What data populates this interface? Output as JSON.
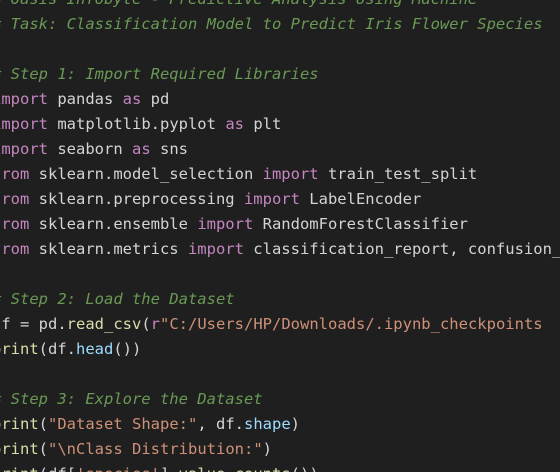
{
  "editor": {
    "colors": {
      "background": "#1f1f1f",
      "comment": "#6a9955",
      "keyword": "#c586c0",
      "function": "#dcdcaa",
      "string": "#ce9178",
      "attribute": "#9cdcfe",
      "plain": "#d4d4d4"
    },
    "lines": [
      [
        {
          "t": "comment",
          "v": "# Oasis Infobyte - Predictive Analysis Using Machine"
        }
      ],
      [
        {
          "t": "comment",
          "v": "# Task: Classification Model to Predict Iris Flower Species"
        }
      ],
      [],
      [
        {
          "t": "comment",
          "v": "# Step 1: Import Required Libraries"
        }
      ],
      [
        {
          "t": "keyword",
          "v": "import"
        },
        {
          "t": "plain",
          "v": " pandas "
        },
        {
          "t": "keyword",
          "v": "as"
        },
        {
          "t": "plain",
          "v": " pd"
        }
      ],
      [
        {
          "t": "keyword",
          "v": "import"
        },
        {
          "t": "plain",
          "v": " matplotlib.pyplot "
        },
        {
          "t": "keyword",
          "v": "as"
        },
        {
          "t": "plain",
          "v": " plt"
        }
      ],
      [
        {
          "t": "keyword",
          "v": "import"
        },
        {
          "t": "plain",
          "v": " seaborn "
        },
        {
          "t": "keyword",
          "v": "as"
        },
        {
          "t": "plain",
          "v": " sns"
        }
      ],
      [
        {
          "t": "keyword",
          "v": "from"
        },
        {
          "t": "plain",
          "v": " sklearn.model_selection "
        },
        {
          "t": "keyword",
          "v": "import"
        },
        {
          "t": "plain",
          "v": " train_test_split"
        }
      ],
      [
        {
          "t": "keyword",
          "v": "from"
        },
        {
          "t": "plain",
          "v": " sklearn.preprocessing "
        },
        {
          "t": "keyword",
          "v": "import"
        },
        {
          "t": "plain",
          "v": " LabelEncoder"
        }
      ],
      [
        {
          "t": "keyword",
          "v": "from"
        },
        {
          "t": "plain",
          "v": " sklearn.ensemble "
        },
        {
          "t": "keyword",
          "v": "import"
        },
        {
          "t": "plain",
          "v": " RandomForestClassifier"
        }
      ],
      [
        {
          "t": "keyword",
          "v": "from"
        },
        {
          "t": "plain",
          "v": " sklearn.metrics "
        },
        {
          "t": "keyword",
          "v": "import"
        },
        {
          "t": "plain",
          "v": " classification_report, confusion_matrix"
        }
      ],
      [],
      [
        {
          "t": "comment",
          "v": "# Step 2: Load the Dataset"
        }
      ],
      [
        {
          "t": "plain",
          "v": "df "
        },
        {
          "t": "op",
          "v": "="
        },
        {
          "t": "plain",
          "v": " pd."
        },
        {
          "t": "func",
          "v": "read_csv"
        },
        {
          "t": "plain",
          "v": "("
        },
        {
          "t": "keyword",
          "v": "r"
        },
        {
          "t": "string",
          "v": "\"C:/Users/HP/Downloads/.ipynb_checkpoints"
        }
      ],
      [
        {
          "t": "func",
          "v": "print"
        },
        {
          "t": "plain",
          "v": "(df."
        },
        {
          "t": "attr",
          "v": "head"
        },
        {
          "t": "plain",
          "v": "())"
        }
      ],
      [],
      [
        {
          "t": "comment",
          "v": "# Step 3: Explore the Dataset"
        }
      ],
      [
        {
          "t": "func",
          "v": "print"
        },
        {
          "t": "plain",
          "v": "("
        },
        {
          "t": "string",
          "v": "\"Dataset Shape:\""
        },
        {
          "t": "plain",
          "v": ", df."
        },
        {
          "t": "attr",
          "v": "shape"
        },
        {
          "t": "plain",
          "v": ")"
        }
      ],
      [
        {
          "t": "func",
          "v": "print"
        },
        {
          "t": "plain",
          "v": "("
        },
        {
          "t": "string",
          "v": "\"\\nClass Distribution:\""
        },
        {
          "t": "plain",
          "v": ")"
        }
      ],
      [
        {
          "t": "func",
          "v": "print"
        },
        {
          "t": "plain",
          "v": "(df["
        },
        {
          "t": "string",
          "v": "'species'"
        },
        {
          "t": "plain",
          "v": "]."
        },
        {
          "t": "func",
          "v": "value_counts"
        },
        {
          "t": "plain",
          "v": "())"
        }
      ]
    ]
  }
}
